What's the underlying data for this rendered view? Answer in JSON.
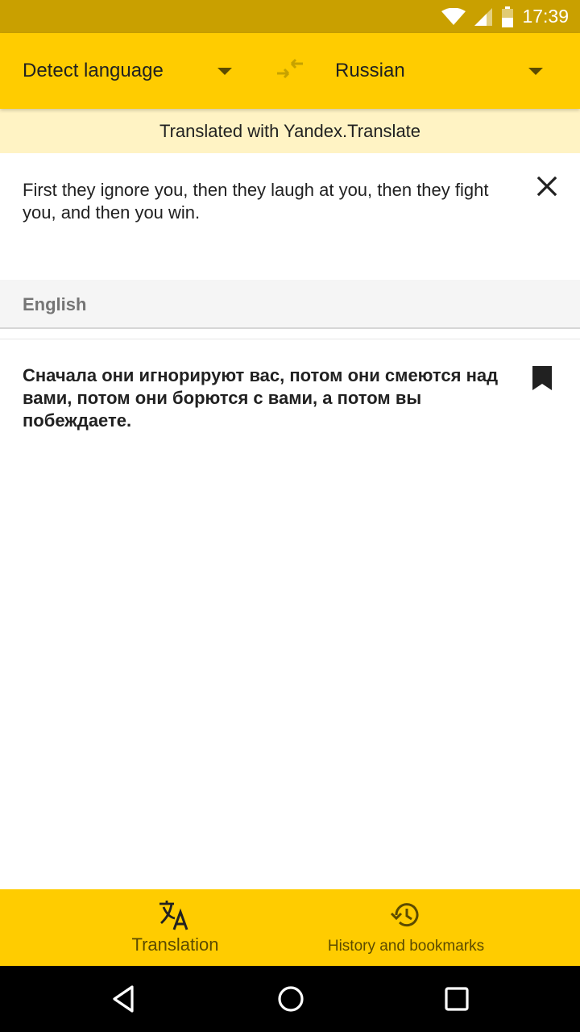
{
  "status_bar": {
    "time": "17:39",
    "icons": [
      "wifi-icon",
      "cell-signal-icon",
      "battery-icon"
    ]
  },
  "toolbar": {
    "source_language": "Detect language",
    "target_language": "Russian",
    "icons": [
      "dropdown-arrow-icon",
      "swap-languages-icon"
    ]
  },
  "banner": {
    "text": "Translated with Yandex.Translate"
  },
  "input": {
    "text": "First they ignore you, then they laugh at you, then they fight you, and then you win."
  },
  "detected_language": {
    "label": "English"
  },
  "output": {
    "text": "Сначала они игнорируют вас, потом они смеются над вами, потом они борются с вами, а потом вы побеждаете."
  },
  "bottom_nav": {
    "tabs": [
      {
        "label": "Translation",
        "icon": "translate-icon",
        "active": true
      },
      {
        "label": "History and bookmarks",
        "icon": "history-icon",
        "active": false
      }
    ]
  },
  "system_nav": {
    "icons": [
      "back-icon",
      "home-icon",
      "recents-icon"
    ]
  },
  "colors": {
    "accent": "#ffcc00",
    "status_bar": "#c9a000",
    "banner": "#fff3c4",
    "nav_text": "#5c4b00"
  }
}
